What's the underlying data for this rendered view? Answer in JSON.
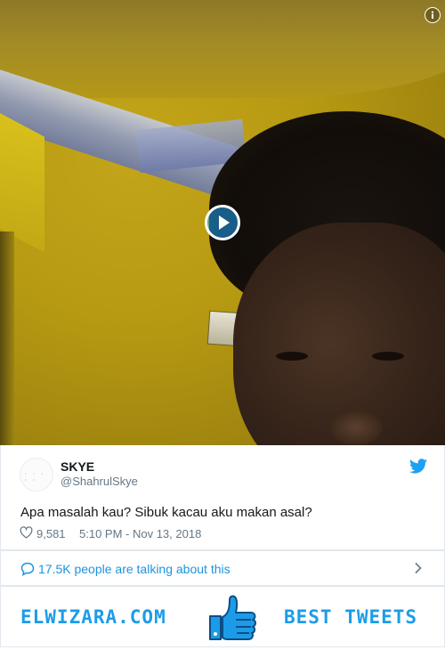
{
  "video": {
    "play_icon": "play-icon",
    "info_icon": "info-icon"
  },
  "tweet": {
    "author_name": "SKYE",
    "author_handle": "@ShahrulSkye",
    "avatar_text": "· · · · ·",
    "text": "Apa masalah kau? Sibuk kacau aku makan asal?",
    "likes": "9,581",
    "timestamp": "5:10 PM - Nov 13, 2018",
    "platform_icon": "twitter-bird-icon"
  },
  "conversation": {
    "label": "17.5K people are talking about this"
  },
  "banner": {
    "site": "ELWIZARA.COM",
    "tagline": "BEST TWEETS",
    "icon": "thumbs-up-icon"
  },
  "colors": {
    "accent": "#1c9ce8",
    "text_primary": "#14171a",
    "text_secondary": "#657786",
    "border": "#e1e8ed"
  }
}
